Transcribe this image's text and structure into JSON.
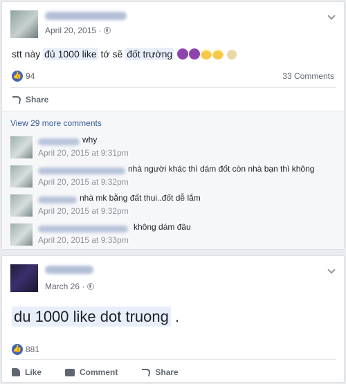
{
  "post1": {
    "date": "April 20, 2015 ·",
    "text_before": "stt này ",
    "hl1": "đủ 1000 like",
    "text_mid": " tớ sẽ ",
    "hl2": "đốt trường",
    "like_count": "94",
    "comment_count": "33 Comments",
    "share_label": "Share",
    "view_more": "View 29 more comments",
    "comments": [
      {
        "text": "why",
        "time": "April 20, 2015 at 9:31pm"
      },
      {
        "text": "nhà người khác thì dám đốt còn nhà bạn thì không",
        "time": "April 20, 2015 at 9:32pm"
      },
      {
        "text": "nhà mk bằng đất thui..đốt dễ lắm",
        "time": "April 20, 2015 at 9:32pm"
      },
      {
        "text": "không dám đâu",
        "time": "April 20, 2015 at 9:33pm"
      }
    ]
  },
  "post2": {
    "date": "March 26 ·",
    "hl": "du 1000 like dot truong",
    "text_after": " .",
    "like_count": "881",
    "like_label": "Like",
    "comment_label": "Comment",
    "share_label": "Share"
  },
  "colors": {
    "like_blue": "#4267b2",
    "link_blue": "#365899",
    "highlight": "#e8eefa"
  },
  "icons": [
    "globe-icon",
    "chevron-down-icon",
    "like-reaction-icon",
    "share-icon",
    "like-icon",
    "comment-icon",
    "devil-emoji-icon",
    "angel-emoji-icon",
    "cookie-emoji-icon"
  ]
}
